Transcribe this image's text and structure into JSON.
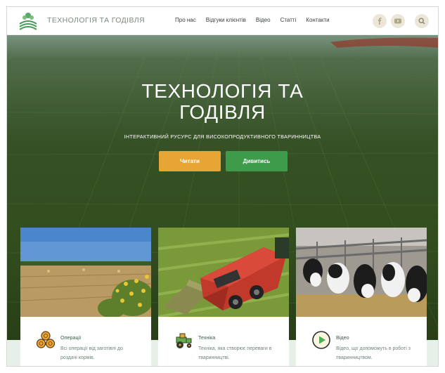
{
  "header": {
    "logo_text": "ТЕХНОЛОГІЯ ТА ГОДІВЛЯ",
    "nav": [
      "Про нас",
      "Відгуки клієнтів",
      "Відео",
      "Статті",
      "Контакти"
    ],
    "social_icons": [
      "facebook-icon",
      "youtube-icon"
    ],
    "search_icon": "search-icon"
  },
  "hero": {
    "title_line1": "ТЕХНОЛОГІЯ ТА",
    "title_line2": "ГОДІВЛЯ",
    "subtitle": "ІНТЕРАКТИВНИЙ РУСУРС ДЛЯ ВИСОКОПРОДУКТИВНОГО ТВАРИННИЦТВА",
    "btn_read": "Читати",
    "btn_watch": "Дивитись"
  },
  "cards": [
    {
      "title": "Операції",
      "text": "Всі операції від заготівлі до роздачі кормів.",
      "icon": "hay-bales-icon"
    },
    {
      "title": "Техніка",
      "text": "Техніка, яка створює переваги в тваринництві.",
      "icon": "tractor-icon"
    },
    {
      "title": "Відео",
      "text": "Відео, що допоможуть в роботі з тваринництвом.",
      "icon": "play-icon"
    }
  ],
  "colors": {
    "accent_orange": "#e7a534",
    "accent_green": "#3f9b4c",
    "social_bg": "#ebe6d8"
  }
}
